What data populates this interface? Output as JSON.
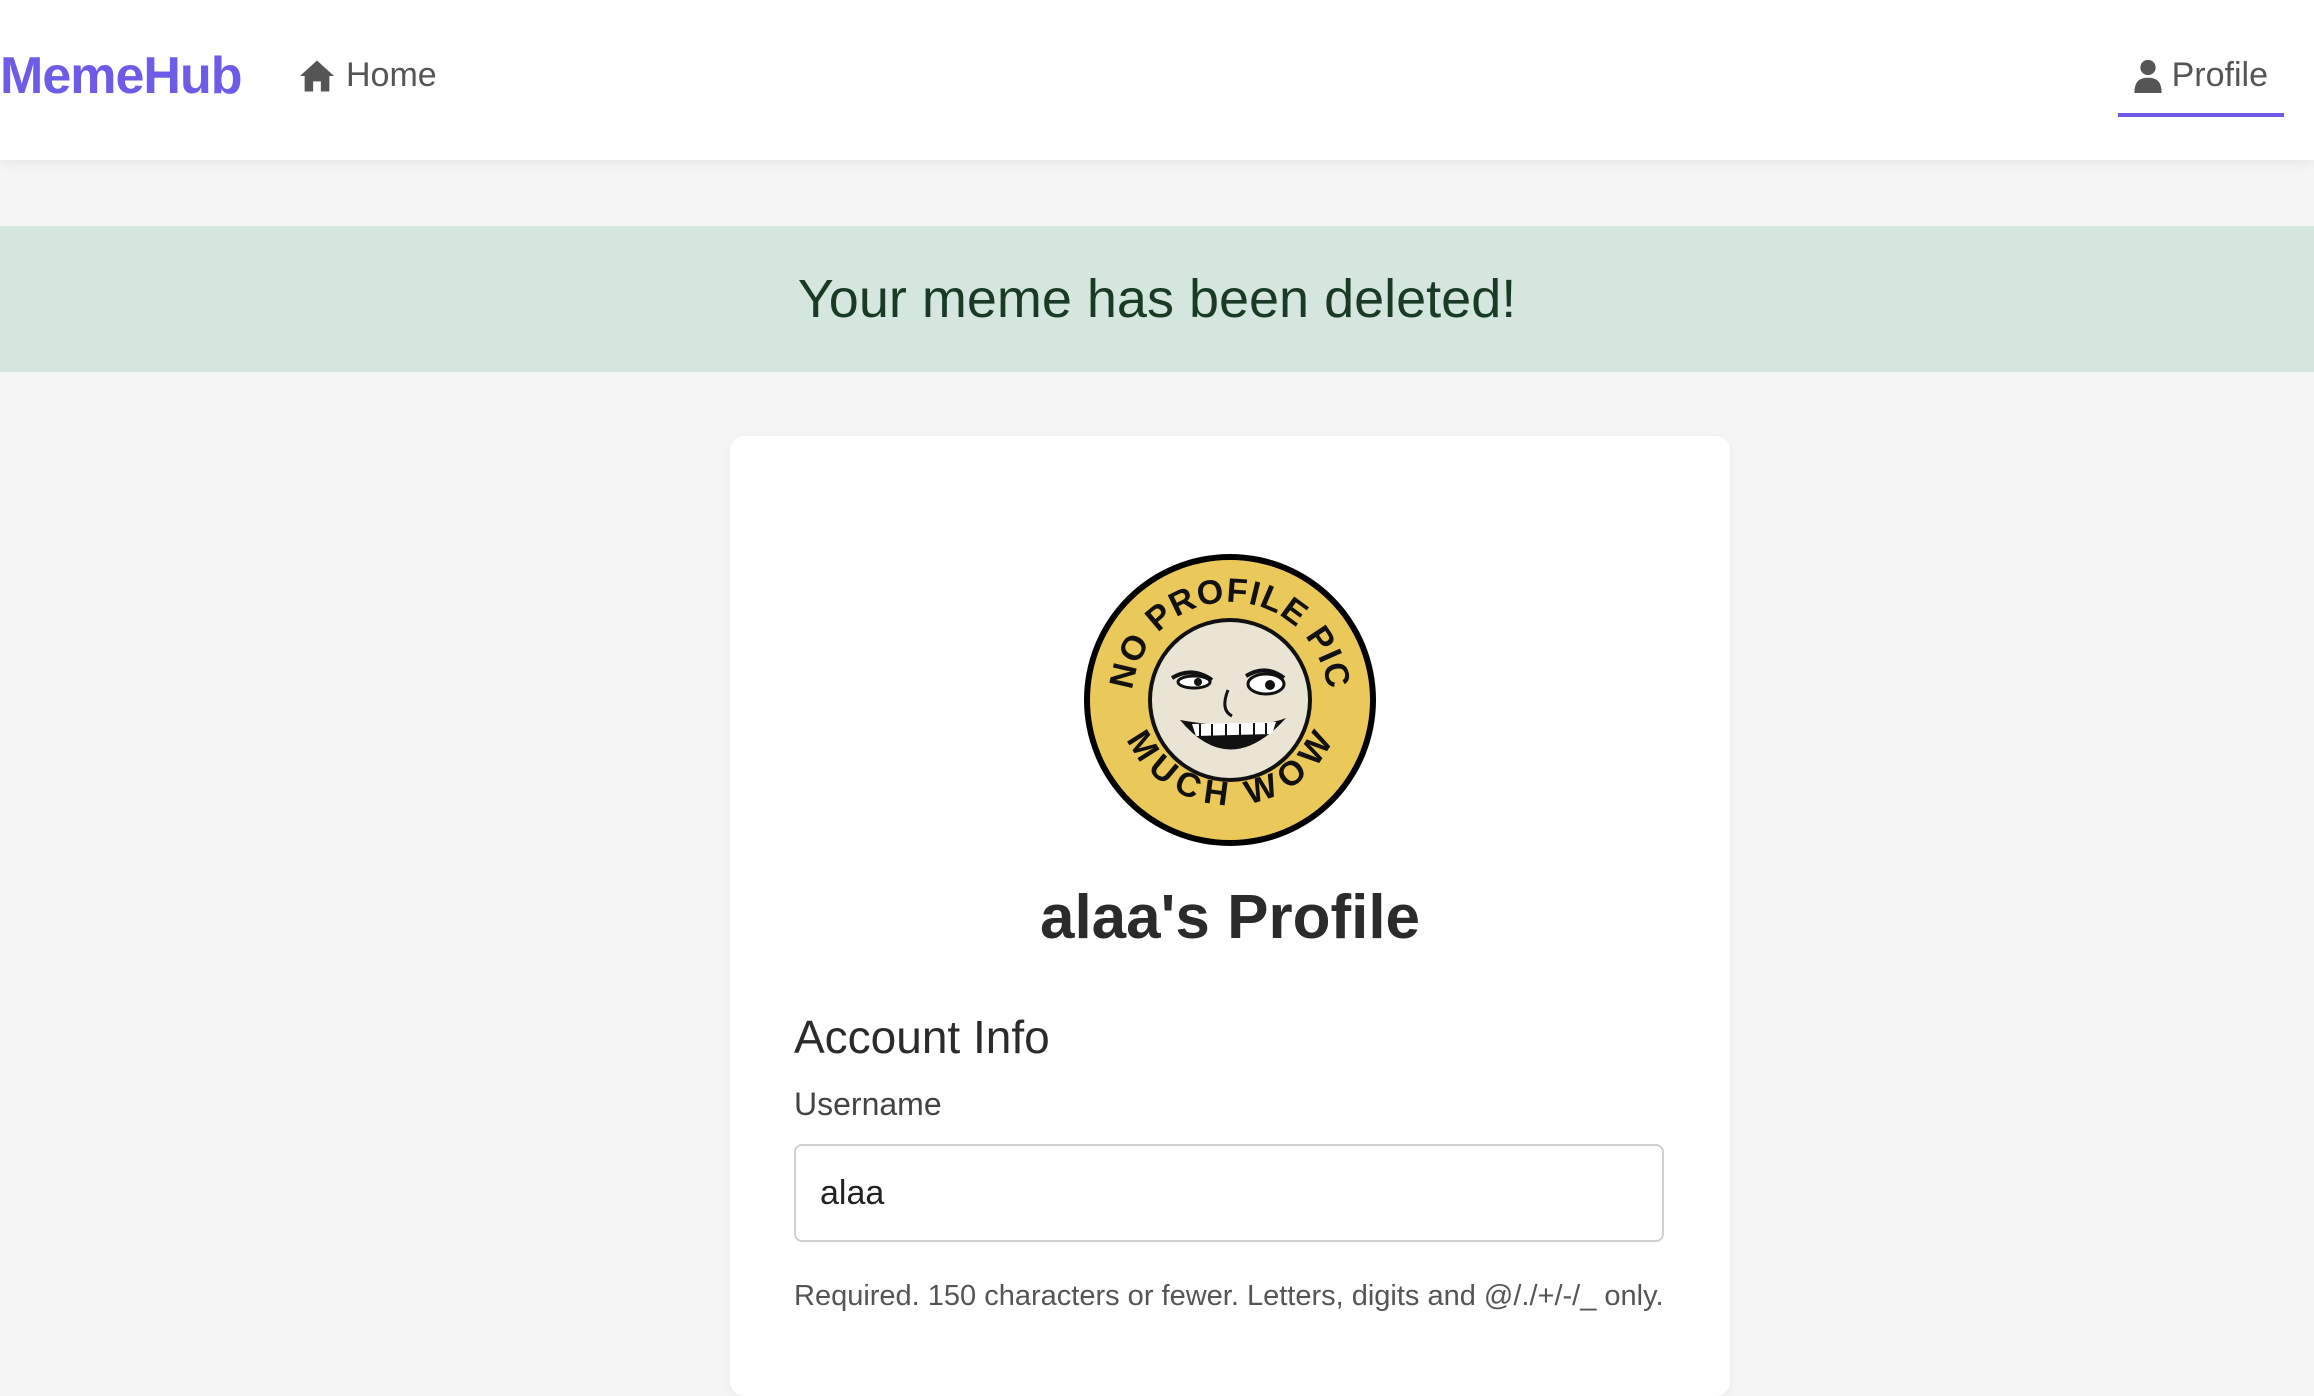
{
  "navbar": {
    "brand": "MemeHub",
    "home_label": "Home",
    "profile_label": "Profile",
    "accent_color": "#6c5ce7"
  },
  "alert": {
    "message": "Your meme has been deleted!",
    "background_color": "#d4e6dd"
  },
  "profile": {
    "avatar_icon": "no-profile-pic-badge",
    "avatar_text_top": "NO PROFILE PIC",
    "avatar_text_bottom": "MUCH WOW",
    "title": "alaa's Profile",
    "section_title": "Account Info",
    "username_label": "Username",
    "username_value": "alaa",
    "username_help": "Required. 150 characters or fewer. Letters, digits and @/./+/-/_ only."
  }
}
